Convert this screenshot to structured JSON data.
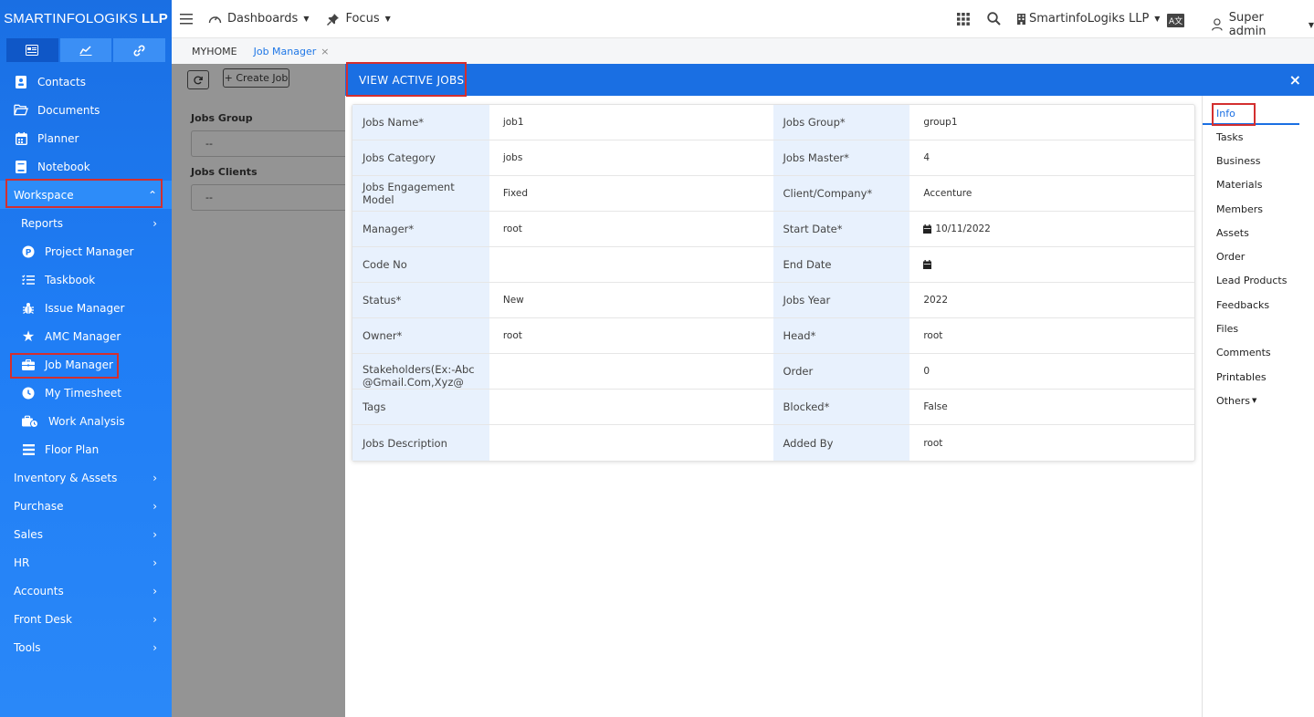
{
  "brand": {
    "name": "SMARTINFOLOGIKS",
    "suffix": "LLP"
  },
  "sidebar": {
    "items": [
      {
        "label": "Contacts"
      },
      {
        "label": "Documents"
      },
      {
        "label": "Planner"
      },
      {
        "label": "Notebook"
      },
      {
        "label": "Workspace"
      },
      {
        "label": "Reports"
      },
      {
        "label": "Project Manager"
      },
      {
        "label": "Taskbook"
      },
      {
        "label": "Issue Manager"
      },
      {
        "label": "AMC Manager"
      },
      {
        "label": "Job Manager"
      },
      {
        "label": "My Timesheet"
      },
      {
        "label": "Work Analysis"
      },
      {
        "label": "Floor Plan"
      },
      {
        "label": "Inventory & Assets"
      },
      {
        "label": "Purchase"
      },
      {
        "label": "Sales"
      },
      {
        "label": "HR"
      },
      {
        "label": "Accounts"
      },
      {
        "label": "Front Desk"
      },
      {
        "label": "Tools"
      }
    ]
  },
  "topbar": {
    "dashboards": "Dashboards",
    "focus": "Focus",
    "company": "SmartinfoLogiks LLP",
    "lang": "A文",
    "user": "Super admin"
  },
  "breadcrumb": {
    "home": "MYHOME",
    "current": "Job Manager",
    "close": "×"
  },
  "overlay": {
    "create_job": "+ Create Job",
    "jobs_group_label": "Jobs Group",
    "jobs_group_value": "--",
    "jobs_clients_label": "Jobs Clients",
    "jobs_clients_value": "--"
  },
  "modal": {
    "title": "VIEW ACTIVE JOBS",
    "close": "×",
    "rows": [
      {
        "l1": "Jobs Name*",
        "v1": "job1",
        "l2": "Jobs Group*",
        "v2": "group1"
      },
      {
        "l1": "Jobs Category",
        "v1": "jobs",
        "l2": "Jobs Master*",
        "v2": "4"
      },
      {
        "l1": "Jobs Engagement Model",
        "v1": "Fixed",
        "l2": "Client/Company*",
        "v2": "Accenture"
      },
      {
        "l1": "Manager*",
        "v1": "root",
        "l2": "Start Date*",
        "v2": "10/11/2022"
      },
      {
        "l1": "Code No",
        "v1": "",
        "l2": "End Date",
        "v2": ""
      },
      {
        "l1": "Status*",
        "v1": "New",
        "l2": "Jobs Year",
        "v2": "2022"
      },
      {
        "l1": "Owner*",
        "v1": "root",
        "l2": "Head*",
        "v2": "root"
      },
      {
        "l1": "Stakeholders(Ex:-Abc@Gmail.Com,Xyz@",
        "v1": "",
        "l2": "Order",
        "v2": "0"
      },
      {
        "l1": "Tags",
        "v1": "",
        "l2": "Blocked*",
        "v2": "False"
      },
      {
        "l1": "Jobs Description",
        "v1": "",
        "l2": "Added By",
        "v2": "root"
      }
    ]
  },
  "right_nav": {
    "items": [
      {
        "label": "Info"
      },
      {
        "label": "Tasks"
      },
      {
        "label": "Business"
      },
      {
        "label": "Materials"
      },
      {
        "label": "Members"
      },
      {
        "label": "Assets"
      },
      {
        "label": "Order"
      },
      {
        "label": "Lead Products"
      },
      {
        "label": "Feedbacks"
      },
      {
        "label": "Files"
      },
      {
        "label": "Comments"
      },
      {
        "label": "Printables"
      },
      {
        "label": "Others"
      }
    ]
  },
  "colors": {
    "primary": "#1a6fe3",
    "highlight": "#d32f2f",
    "label_bg": "#e8f1fd",
    "overlay": "#949494"
  }
}
